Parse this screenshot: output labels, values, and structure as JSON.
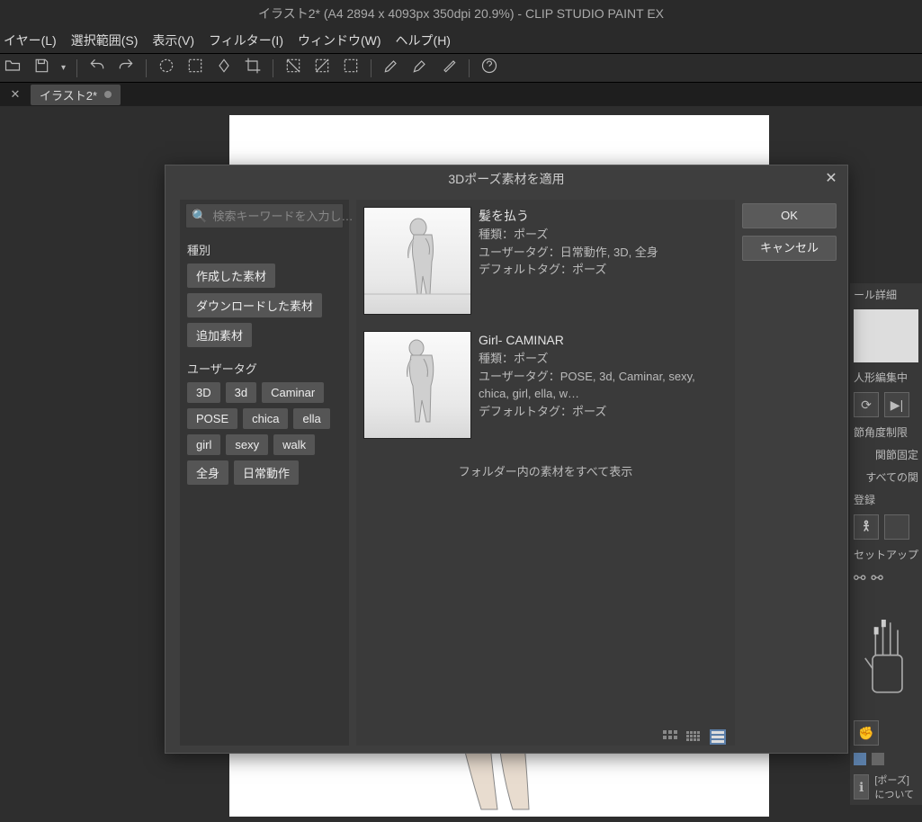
{
  "titlebar": "イラスト2* (A4 2894 x 4093px 350dpi 20.9%)  - CLIP STUDIO PAINT EX",
  "menu": {
    "layer": "イヤー(L)",
    "select": "選択範囲(S)",
    "view": "表示(V)",
    "filter": "フィルター(I)",
    "window": "ウィンドウ(W)",
    "help": "ヘルプ(H)"
  },
  "tab": {
    "label": "イラスト2*"
  },
  "modal": {
    "title": "3Dポーズ素材を適用",
    "search_placeholder": "検索キーワードを入力し…",
    "section_type": "種別",
    "type_chips": [
      "作成した素材",
      "ダウンロードした素材",
      "追加素材"
    ],
    "section_usertag": "ユーザータグ",
    "usertag_chips": [
      "3D",
      "3d",
      "Caminar",
      "POSE",
      "chica",
      "ella",
      "girl",
      "sexy",
      "walk",
      "全身",
      "日常動作"
    ],
    "show_all": "フォルダー内の素材をすべて表示",
    "ok": "OK",
    "cancel": "キャンセル"
  },
  "results": [
    {
      "title": "髪を払う",
      "kind": "種類：ポーズ",
      "usertags": "ユーザータグ：日常動作, 3D, 全身",
      "deftags": "デフォルトタグ：ポーズ"
    },
    {
      "title": "Girl- CAMINAR",
      "kind": "種類：ポーズ",
      "usertags": "ユーザータグ：POSE, 3d, Caminar, sexy, chica, girl, ella, w…",
      "deftags": "デフォルトタグ：ポーズ"
    }
  ],
  "side": {
    "detail": "ール詳細",
    "edit": "人形編集中",
    "joint_limit": "節角度制限",
    "joint_fix": "関節固定",
    "all_joint": "すべての関",
    "register": "登録",
    "setup": "セットアップ",
    "about": "[ポーズ]について"
  }
}
